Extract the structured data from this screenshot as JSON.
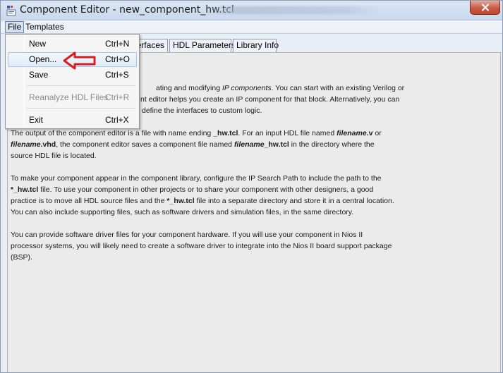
{
  "window": {
    "title": "Component Editor - new_component_hw.tcl"
  },
  "menubar": {
    "file": "File",
    "templates": "Templates"
  },
  "tabs": [
    {
      "label": "erfaces"
    },
    {
      "label": "HDL Parameters"
    },
    {
      "label": "Library Info"
    }
  ],
  "file_menu": {
    "items": [
      {
        "label": "New",
        "shortcut": "Ctrl+N",
        "enabled": true
      },
      {
        "label": "Open...",
        "shortcut": "Ctrl+O",
        "enabled": true,
        "highlighted": true
      },
      {
        "label": "Save",
        "shortcut": "Ctrl+S",
        "enabled": true
      },
      {
        "label": "Reanalyze HDL Files",
        "shortcut": "Ctrl+R",
        "enabled": false
      },
      {
        "label": "Exit",
        "shortcut": "Ctrl+X",
        "enabled": true
      }
    ]
  },
  "content": {
    "p1": {
      "l1a": "ating and modifying ",
      "l1b": "IP components",
      "l1c": ". You can start with an existing Verilog or",
      "l2": "nt editor helps you create an IP component for that block. Alternatively, you can",
      "l3": "define the interfaces to custom logic."
    },
    "p2": {
      "l1a": "The output of the component editor is a file with name ending ",
      "l1b": "_hw.tcl",
      "l1c": ". For an input HDL file named ",
      "l1d": "filename",
      "l1e": ".v",
      "l1f": " or",
      "l2a": "filename",
      "l2b": ".vhd",
      "l2c": ", the component editor saves a component file named ",
      "l2d": "filename",
      "l2e": "_hw.tcl",
      "l2f": " in the directory where the",
      "l3": "source HDL file is located."
    },
    "p3": {
      "l1": "To make your component appear in the component library, configure the IP Search Path to include the path to the",
      "l2a": "*_hw.tcl",
      "l2b": " file. To use your component in other projects or to share your component with other designers, a good",
      "l3a": "practice is to move all HDL source files and the ",
      "l3b": "*_hw.tcl",
      "l3c": " file into a separate directory and store it in a central location.",
      "l4": "You can also include supporting files, such as software drivers and simulation files, in the same directory."
    },
    "p4": {
      "l1": "You can provide software driver files for your component hardware. If you will use your component in Nios II",
      "l2": "processor systems, you will likely need to create a software driver to integrate into the Nios II board support package",
      "l3": "(BSP)."
    }
  },
  "icons": {
    "app": "component-editor-icon",
    "close": "close-icon",
    "annotation": "red-arrow-annotation"
  },
  "colors": {
    "annotation_red": "#d61f1f",
    "close_red": "#c75a45"
  }
}
